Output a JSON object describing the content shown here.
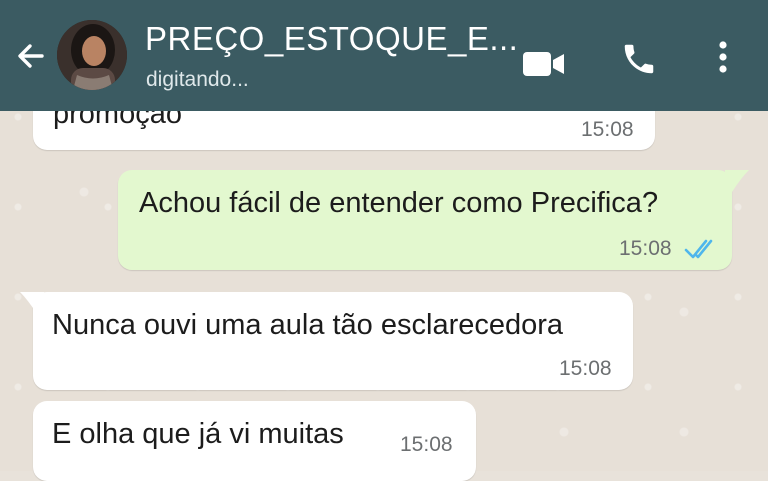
{
  "header": {
    "contact_name": "PREÇO_ESTOQUE_E...",
    "status": "digitando..."
  },
  "messages": [
    {
      "direction": "in",
      "text": "promoção",
      "time": "15:08"
    },
    {
      "direction": "out",
      "text": "Achou fácil de entender como Precifica?",
      "time": "15:08",
      "status": "read"
    },
    {
      "direction": "in",
      "text": "Nunca ouvi uma aula tão esclarecedora",
      "time": "15:08"
    },
    {
      "direction": "in",
      "text": "E olha que já vi muitas",
      "time": "15:08"
    }
  ],
  "colors": {
    "header": "#3b5b62",
    "outgoing_bubble": "#e3f8cf",
    "incoming_bubble": "#ffffff",
    "read_ticks": "#4fb6ec"
  },
  "icons": [
    "back-arrow-icon",
    "video-call-icon",
    "phone-icon",
    "more-options-icon"
  ]
}
